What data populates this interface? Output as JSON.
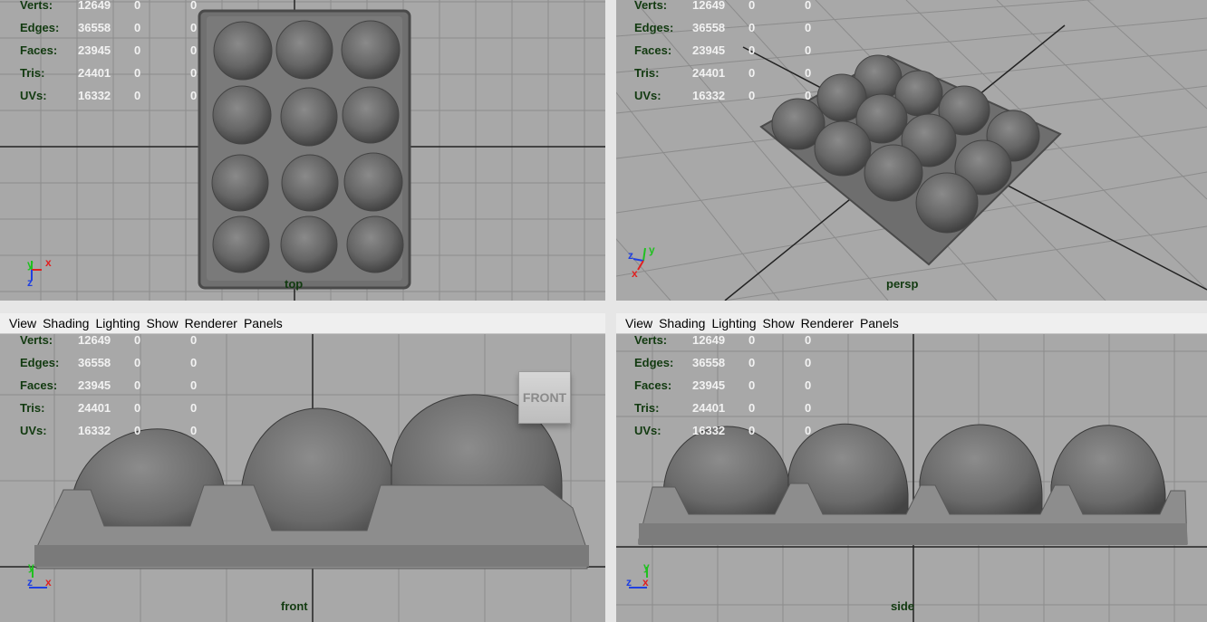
{
  "menu": [
    "View",
    "Shading",
    "Lighting",
    "Show",
    "Renderer",
    "Panels"
  ],
  "hud": {
    "rows": [
      {
        "label": "Verts:",
        "value": "12649",
        "sel": "0",
        "comp": "0"
      },
      {
        "label": "Edges:",
        "value": "36558",
        "sel": "0",
        "comp": "0"
      },
      {
        "label": "Faces:",
        "value": "23945",
        "sel": "0",
        "comp": "0"
      },
      {
        "label": "Tris:",
        "value": "24401",
        "sel": "0",
        "comp": "0"
      },
      {
        "label": "UVs:",
        "value": "16332",
        "sel": "0",
        "comp": "0"
      }
    ]
  },
  "viewports": {
    "top": {
      "camera": "top",
      "axes": [
        "y",
        "x",
        "z"
      ]
    },
    "persp": {
      "camera": "persp",
      "axes": [
        "z",
        "y",
        "x"
      ]
    },
    "front": {
      "camera": "front",
      "axes": [
        "y",
        "z",
        "x"
      ],
      "viewcube": "FRONT"
    },
    "side": {
      "camera": "side",
      "axes": [
        "y",
        "z",
        "x"
      ]
    }
  },
  "colors": {
    "viewport_bg": "#a8a8a8",
    "grid": "#8c8c8c",
    "origin_axis": "#222222",
    "hud_label": "#123a10",
    "hud_value": "#f2f2f2",
    "axis_x": "#e02020",
    "axis_y": "#20c020",
    "axis_z": "#2040e0"
  }
}
